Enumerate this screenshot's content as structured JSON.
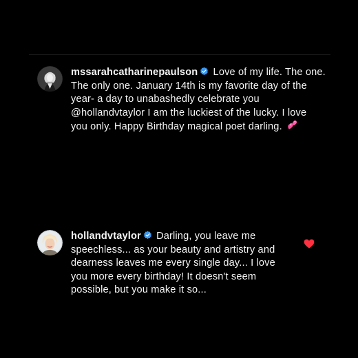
{
  "comments": [
    {
      "username": "mssarahcatharinepaulson",
      "verified": true,
      "text_before": "Love of my life. The one. The only one.  January 14th is my favorite day of the year- a day to unabashedly celebrate you ",
      "mention": "@hollandvtaylor",
      "text_after": " I am the luckiest of the lucky. I love you only. Happy Birthday magical poet darling.",
      "emoji": "two-hearts-emoji",
      "liked": false
    },
    {
      "username": "hollandvtaylor",
      "verified": true,
      "text": "Darling, you leave me speechless... as your beauty and artistry and dearness leaves me every single day... I love you more every birthday! It doesn't seem possible, but you make it so...",
      "liked": true,
      "like_color": "#ff3040"
    }
  ],
  "colors": {
    "background": "#000000",
    "text": "#f5f5f5",
    "verified_badge": "#3897f0",
    "like": "#ff3040"
  }
}
